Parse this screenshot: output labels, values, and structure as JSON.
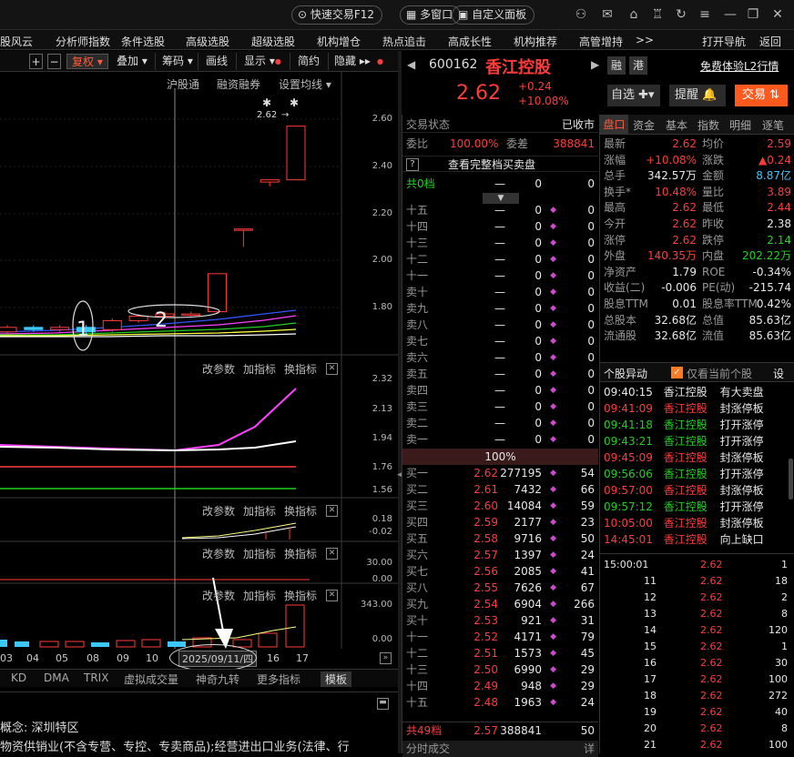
{
  "topbar": {
    "quick_trade": "快速交易F12",
    "multi_window": "多窗口",
    "custom_panel": "自定义面板"
  },
  "menu": [
    "股风云",
    "分析师指数",
    "条件选股",
    "高级选股",
    "超级选股",
    "机构增仓",
    "热点追击",
    "高成长性",
    "机构推荐",
    "高管增持",
    ">>",
    "打开导航",
    "返回"
  ],
  "toolbar": {
    "plus": "+",
    "minus": "−",
    "fuquan": "复权",
    "overlay": "叠加",
    "chips": "筹码",
    "draw": "画线",
    "display": "显示",
    "brief": "简约",
    "hide": "隐藏"
  },
  "chart": {
    "main_titles": [
      "沪股通",
      "融资融券",
      "设置均线"
    ],
    "price_label": "2.62",
    "y_main": [
      "2.60",
      "2.40",
      "2.20",
      "2.00",
      "1.80"
    ],
    "annot1": "1",
    "annot2": "2",
    "sub_titles": [
      "改参数",
      "加指标",
      "换指标"
    ],
    "y_sub1": [
      "2.32",
      "2.13",
      "1.94",
      "1.76",
      "1.56"
    ],
    "y_sub2": [
      "0.18",
      "-0.02"
    ],
    "y_sub3": [
      "30.00",
      "0.00"
    ],
    "y_sub4": [
      "343.00",
      "0.00"
    ],
    "x_labels": [
      "03",
      "04",
      "05",
      "08",
      "09",
      "10",
      "2025/09/11/四",
      "16",
      "17"
    ]
  },
  "chart_data": {
    "type": "candlestick",
    "candles": [
      {
        "o": 1.7,
        "c": 1.72,
        "h": 1.73,
        "l": 1.69
      },
      {
        "o": 1.72,
        "c": 1.71,
        "h": 1.73,
        "l": 1.7
      },
      {
        "o": 1.71,
        "c": 1.72,
        "h": 1.73,
        "l": 1.7
      },
      {
        "o": 1.72,
        "c": 1.7,
        "h": 1.73,
        "l": 1.69
      },
      {
        "o": 1.71,
        "c": 1.75,
        "h": 1.76,
        "l": 1.7
      },
      {
        "o": 1.75,
        "c": 1.77,
        "h": 1.78,
        "l": 1.74
      },
      {
        "o": 1.77,
        "c": 1.78,
        "h": 1.79,
        "l": 1.76
      },
      {
        "o": 1.78,
        "c": 1.78,
        "h": 1.79,
        "l": 1.77
      },
      {
        "o": 1.79,
        "c": 1.96,
        "h": 1.96,
        "l": 1.78
      },
      {
        "o": 2.16,
        "c": 2.16,
        "h": 2.16,
        "l": 2.08
      },
      {
        "o": 2.37,
        "c": 2.38,
        "h": 2.38,
        "l": 2.35
      },
      {
        "o": 2.38,
        "c": 2.62,
        "h": 2.62,
        "l": 2.45
      }
    ],
    "ylim": [
      1.65,
      2.7
    ]
  },
  "tabs": [
    "KD",
    "DMA",
    "TRIX",
    "虚拟成交量",
    "神奇九转",
    "更多指标",
    "模板"
  ],
  "info": {
    "line1": "概念: 深圳特区",
    "line2": "物资供销业(不含专营、专控、专卖商品);经营进出口业务(法律、行"
  },
  "stock": {
    "code": "600162",
    "name": "香江控股",
    "price": "2.62",
    "chg": "+0.24",
    "pct": "+10.08%",
    "rong": "融",
    "gang": "港",
    "l2": "免费体验L2行情",
    "zixuan": "自选",
    "tixing": "提醒",
    "jiaoyi": "交易"
  },
  "order": {
    "status_label": "交易状态",
    "status_val": "已收市",
    "weibi_label": "委比",
    "weibi_val": "100.00%",
    "weicha_label": "委差",
    "weicha_val": "388841",
    "full_book": "查看完整档买卖盘",
    "total_ask_label": "共0档",
    "total_ask_a": "—",
    "total_ask_b": "0",
    "total_ask_c": "0",
    "asks": [
      "十五",
      "十四",
      "十三",
      "十二",
      "十一",
      "卖十",
      "卖九",
      "卖八",
      "卖七",
      "卖六",
      "卖五",
      "卖四",
      "卖三",
      "卖二",
      "卖一"
    ],
    "ask_price": "—",
    "ask_vol": "0",
    "mid_pct": "100%",
    "bids": [
      [
        "买一",
        "2.62",
        "277195",
        "54"
      ],
      [
        "买二",
        "2.61",
        "7432",
        "66"
      ],
      [
        "买三",
        "2.60",
        "14084",
        "59"
      ],
      [
        "买四",
        "2.59",
        "2177",
        "23"
      ],
      [
        "买五",
        "2.58",
        "9716",
        "50"
      ],
      [
        "买六",
        "2.57",
        "1397",
        "24"
      ],
      [
        "买七",
        "2.56",
        "2085",
        "41"
      ],
      [
        "买八",
        "2.55",
        "7626",
        "67"
      ],
      [
        "买九",
        "2.54",
        "6904",
        "266"
      ],
      [
        "买十",
        "2.53",
        "921",
        "31"
      ],
      [
        "十一",
        "2.52",
        "4171",
        "79"
      ],
      [
        "十二",
        "2.51",
        "1573",
        "45"
      ],
      [
        "十三",
        "2.50",
        "6990",
        "29"
      ],
      [
        "十四",
        "2.49",
        "948",
        "29"
      ],
      [
        "十五",
        "2.48",
        "1963",
        "24"
      ]
    ],
    "total_bid": [
      "共49档",
      "2.57",
      "388841",
      "50"
    ],
    "fenshi": "分时成交",
    "detail": "详"
  },
  "quote_tabs": [
    "盘口",
    "资金",
    "基本",
    "指数",
    "明细",
    "资",
    "逐笔"
  ],
  "quote": [
    [
      "最新",
      "2.62",
      "均价",
      "2.59"
    ],
    [
      "涨幅",
      "+10.08%",
      "涨跌",
      "▲0.24"
    ],
    [
      "总手",
      "342.57万",
      "金额",
      "8.87亿"
    ],
    [
      "换手*",
      "10.48%",
      "量比",
      "3.89"
    ],
    [
      "最高",
      "2.62",
      "最低",
      "2.44"
    ],
    [
      "今开",
      "2.62",
      "昨收",
      "2.38"
    ],
    [
      "涨停",
      "2.62",
      "跌停",
      "2.14"
    ],
    [
      "外盘",
      "140.35万",
      "内盘",
      "202.22万"
    ],
    [
      "净资产",
      "1.79",
      "ROE",
      "-0.34%"
    ],
    [
      "收益(二)",
      "-0.006",
      "PE(动)",
      "-215.74"
    ],
    [
      "股息TTM",
      "0.01",
      "股息率TTM",
      "0.42%"
    ],
    [
      "总股本",
      "32.68亿",
      "总值",
      "85.63亿"
    ],
    [
      "流通股",
      "32.68亿",
      "流值",
      "85.63亿"
    ]
  ],
  "alerts_title": "个股异动",
  "alerts_check": "仅看当前个股",
  "alerts_set": "设",
  "alerts": [
    [
      "09:40:15",
      "香江控股",
      "有大卖盘"
    ],
    [
      "09:41:09",
      "香江控股",
      "封涨停板"
    ],
    [
      "09:41:18",
      "香江控股",
      "打开涨停"
    ],
    [
      "09:43:21",
      "香江控股",
      "打开涨停"
    ],
    [
      "09:45:09",
      "香江控股",
      "封涨停板"
    ],
    [
      "09:56:06",
      "香江控股",
      "打开涨停"
    ],
    [
      "09:57:00",
      "香江控股",
      "封涨停板"
    ],
    [
      "09:57:12",
      "香江控股",
      "打开涨停"
    ],
    [
      "10:05:00",
      "香江控股",
      "封涨停板"
    ],
    [
      "14:45:01",
      "香江控股",
      "向上缺口"
    ]
  ],
  "ticks": [
    [
      "15:00:01",
      "2.62",
      "1"
    ],
    [
      "11",
      "2.62",
      "18"
    ],
    [
      "12",
      "2.62",
      "2"
    ],
    [
      "13",
      "2.62",
      "8"
    ],
    [
      "14",
      "2.62",
      "120"
    ],
    [
      "15",
      "2.62",
      "1"
    ],
    [
      "16",
      "2.62",
      "30"
    ],
    [
      "17",
      "2.62",
      "100"
    ],
    [
      "18",
      "2.62",
      "272"
    ],
    [
      "19",
      "2.62",
      "40"
    ],
    [
      "20",
      "2.62",
      "8"
    ],
    [
      "21",
      "2.62",
      "100"
    ]
  ],
  "colors": {
    "up": "#ff3c3c",
    "down": "#20d020",
    "accent": "#ff5a1e"
  }
}
